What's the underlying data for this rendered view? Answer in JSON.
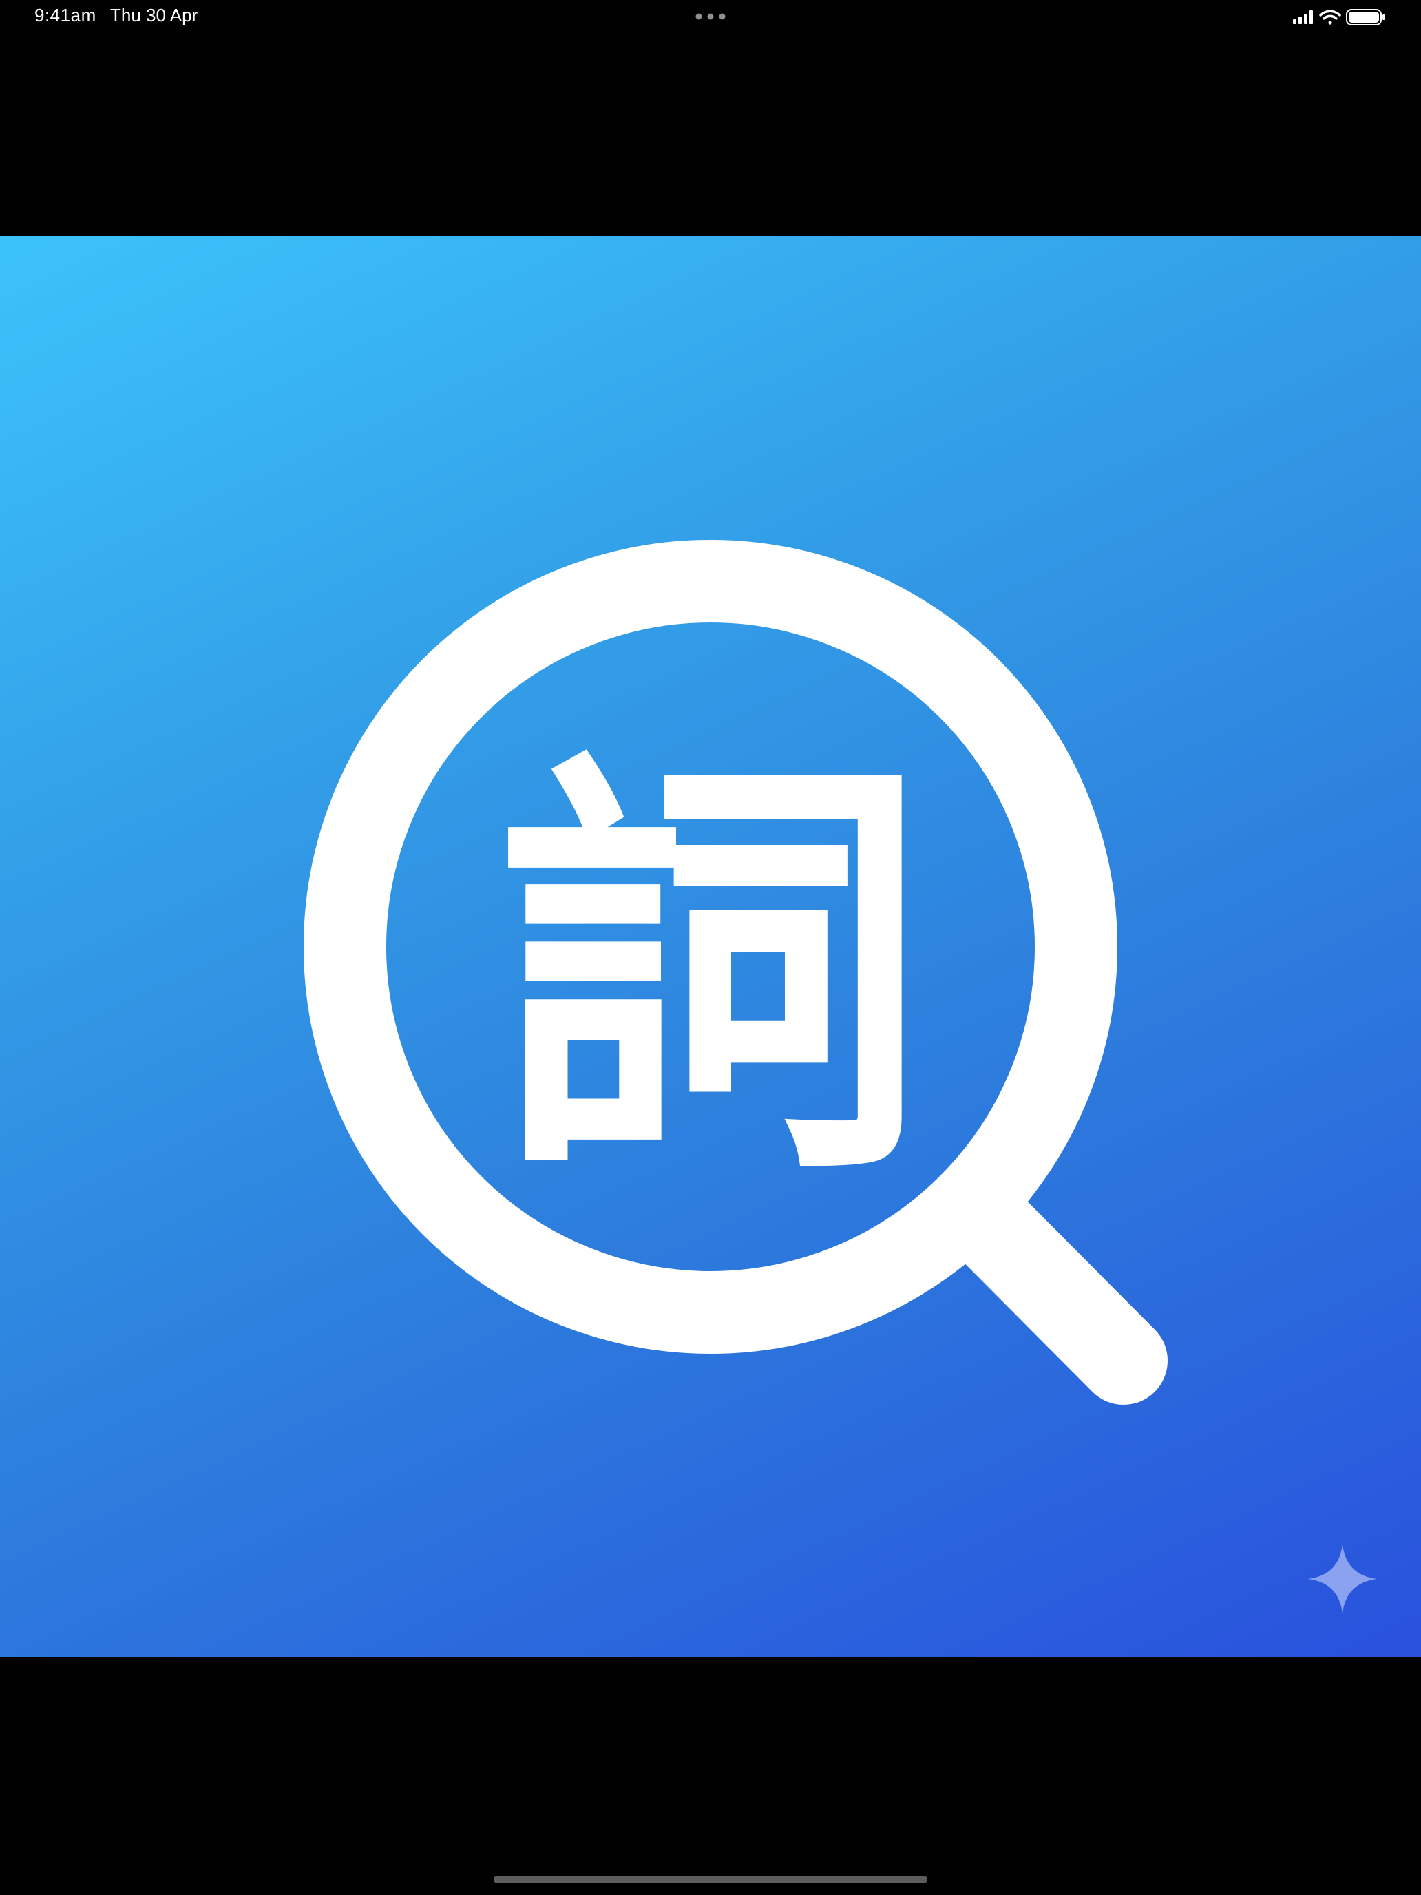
{
  "status_bar": {
    "time": "9:41am",
    "date": "Thu 30 Apr"
  },
  "splash": {
    "logo_glyph": "詞",
    "icon": "magnifying-glass-icon",
    "gradient_colors": [
      "#3cc3fb",
      "#2951dd"
    ]
  },
  "sparkle": {
    "icon": "sparkle-icon",
    "color": "#8fa6f0"
  }
}
